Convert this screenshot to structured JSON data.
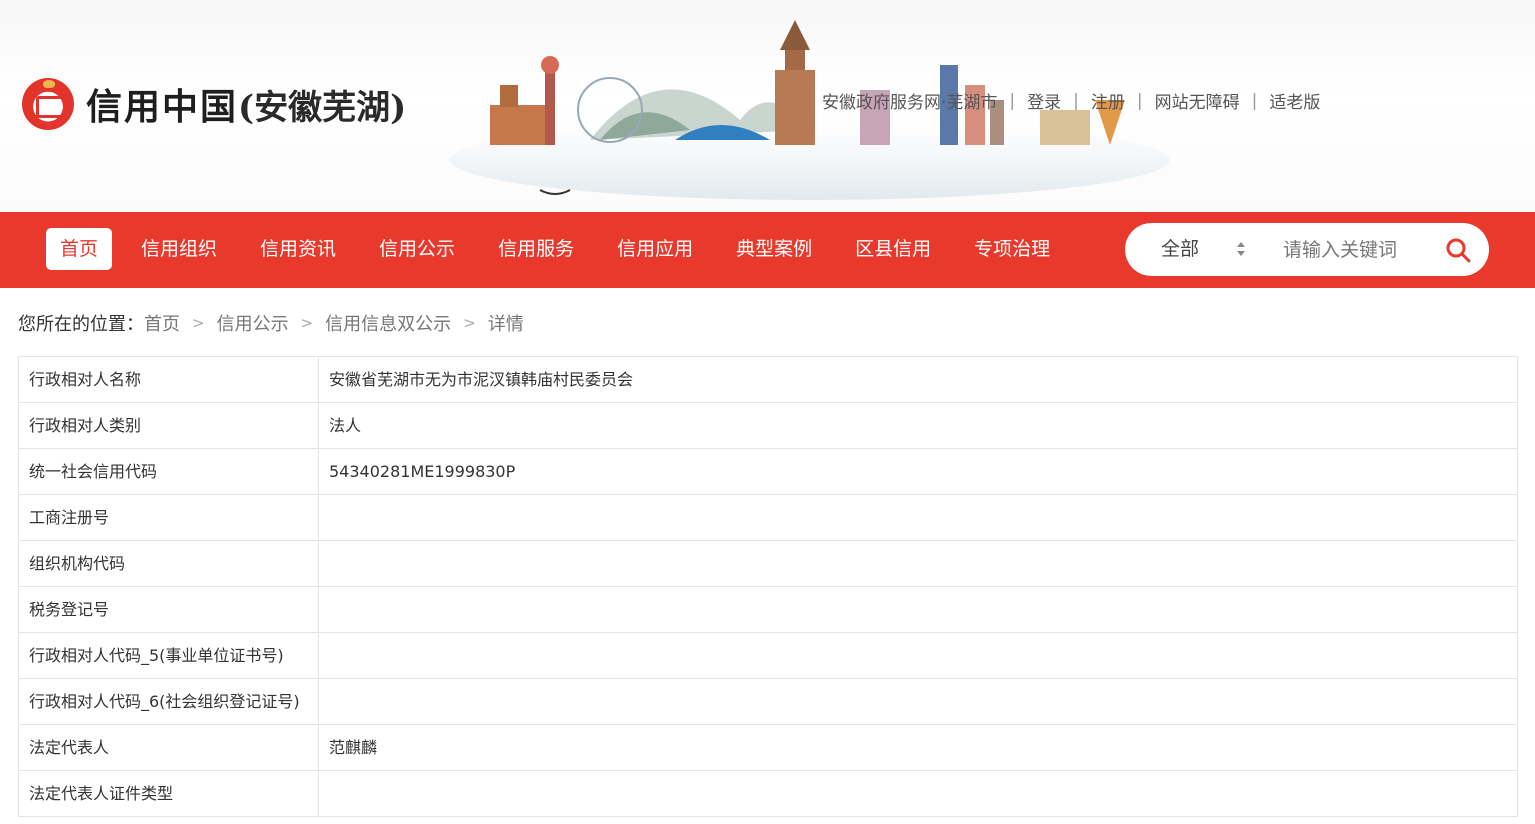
{
  "header": {
    "logo_title": "信用中国",
    "logo_sub": "(安徽芜湖)",
    "links": [
      "安徽政府服务网·芜湖市",
      "登录",
      "注册",
      "网站无障碍",
      "适老版"
    ]
  },
  "nav": {
    "items": [
      "首页",
      "信用组织",
      "信用资讯",
      "信用公示",
      "信用服务",
      "信用应用",
      "典型案例",
      "区县信用",
      "专项治理"
    ],
    "active_index": 0
  },
  "search": {
    "scope": "全部",
    "placeholder": "请输入关键词",
    "icon": "search-icon"
  },
  "breadcrumb": {
    "prefix": "您所在的位置：",
    "items": [
      "首页",
      "信用公示",
      "信用信息双公示",
      "详情"
    ]
  },
  "detail": {
    "rows": [
      {
        "label": "行政相对人名称",
        "value": "安徽省芜湖市无为市泥汊镇韩庙村民委员会"
      },
      {
        "label": "行政相对人类别",
        "value": "法人"
      },
      {
        "label": "统一社会信用代码",
        "value": "54340281ME1999830P"
      },
      {
        "label": "工商注册号",
        "value": ""
      },
      {
        "label": "组织机构代码",
        "value": ""
      },
      {
        "label": "税务登记号",
        "value": ""
      },
      {
        "label": "行政相对人代码_5(事业单位证书号)",
        "value": ""
      },
      {
        "label": "行政相对人代码_6(社会组织登记证号)",
        "value": ""
      },
      {
        "label": "法定代表人",
        "value": "范麒麟"
      },
      {
        "label": "法定代表人证件类型",
        "value": ""
      }
    ]
  },
  "colors": {
    "brand_red": "#e8392c",
    "nav_text": "#ffffff",
    "border": "#e4e4e4"
  }
}
